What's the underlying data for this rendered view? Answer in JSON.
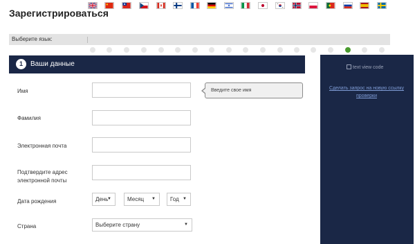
{
  "page": {
    "title": "Зарегистрироваться"
  },
  "language": {
    "label": "Выберите язык:",
    "flags": [
      {
        "icon": "flag-uk-icon"
      },
      {
        "icon": "flag-china-icon"
      },
      {
        "icon": "flag-taiwan-icon"
      },
      {
        "icon": "flag-czech-icon"
      },
      {
        "icon": "flag-canada-icon"
      },
      {
        "icon": "flag-finland-icon"
      },
      {
        "icon": "flag-france-icon"
      },
      {
        "icon": "flag-germany-icon"
      },
      {
        "icon": "flag-israel-icon"
      },
      {
        "icon": "flag-italy-icon"
      },
      {
        "icon": "flag-japan-icon"
      },
      {
        "icon": "flag-korea-icon"
      },
      {
        "icon": "flag-norway-icon"
      },
      {
        "icon": "flag-poland-icon"
      },
      {
        "icon": "flag-portugal-icon"
      },
      {
        "icon": "flag-russia-icon"
      },
      {
        "icon": "flag-spain-icon"
      },
      {
        "icon": "flag-sweden-icon"
      }
    ],
    "selected_index": 15
  },
  "step": {
    "number": "1",
    "title": "Ваши данные"
  },
  "form": {
    "first_name": {
      "label": "Имя",
      "value": ""
    },
    "last_name": {
      "label": "Фамилия",
      "value": ""
    },
    "email": {
      "label": "Электронная почта",
      "value": ""
    },
    "email_confirm": {
      "label_line1": "Подтвердите адрес",
      "label_line2": "электронной почты",
      "value": ""
    },
    "birth_date": {
      "label": "Дата рождения",
      "day": "День",
      "month": "Месяц",
      "year": "Год"
    },
    "country": {
      "label": "Страна",
      "value": "Выберите страну"
    },
    "tooltip": "Введите свое имя"
  },
  "side": {
    "image_alt": "text view code",
    "link_line1": "Сделать запрос на новую ссылку",
    "link_line2": "проверки"
  },
  "colors": {
    "header_bg": "#1a2746",
    "selected_radio": "#4a9b2f",
    "link": "#7f9cd6"
  }
}
